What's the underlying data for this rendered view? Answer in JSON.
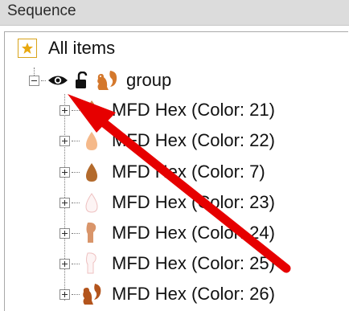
{
  "panel": {
    "title": "Sequence"
  },
  "tree": {
    "root": {
      "label": "All items"
    },
    "group": {
      "label": "group"
    },
    "items": [
      {
        "label": "MFD Hex (Color: 21)",
        "icon": "flame-icon",
        "color": "#d08a4e"
      },
      {
        "label": "MFD Hex (Color: 22)",
        "icon": "drop-icon",
        "color": "#f5b98a"
      },
      {
        "label": "MFD Hex (Color: 7)",
        "icon": "drop-icon",
        "color": "#b36a2c"
      },
      {
        "label": "MFD Hex (Color: 23)",
        "icon": "drop-outline-icon",
        "color": "#f3d3d3"
      },
      {
        "label": "MFD Hex (Color: 24)",
        "icon": "boot-icon",
        "color": "#d9956a"
      },
      {
        "label": "MFD Hex (Color: 25)",
        "icon": "boot-outline-icon",
        "color": "#f3d3d3"
      },
      {
        "label": "MFD Hex (Color: 26)",
        "icon": "squirrel-icon",
        "color": "#b3541c"
      }
    ]
  },
  "colors": {
    "header_bg": "#dcdcdc",
    "star": "#d8a31a",
    "squirrel": "#d4782c",
    "annotation_arrow": "#e60000"
  }
}
